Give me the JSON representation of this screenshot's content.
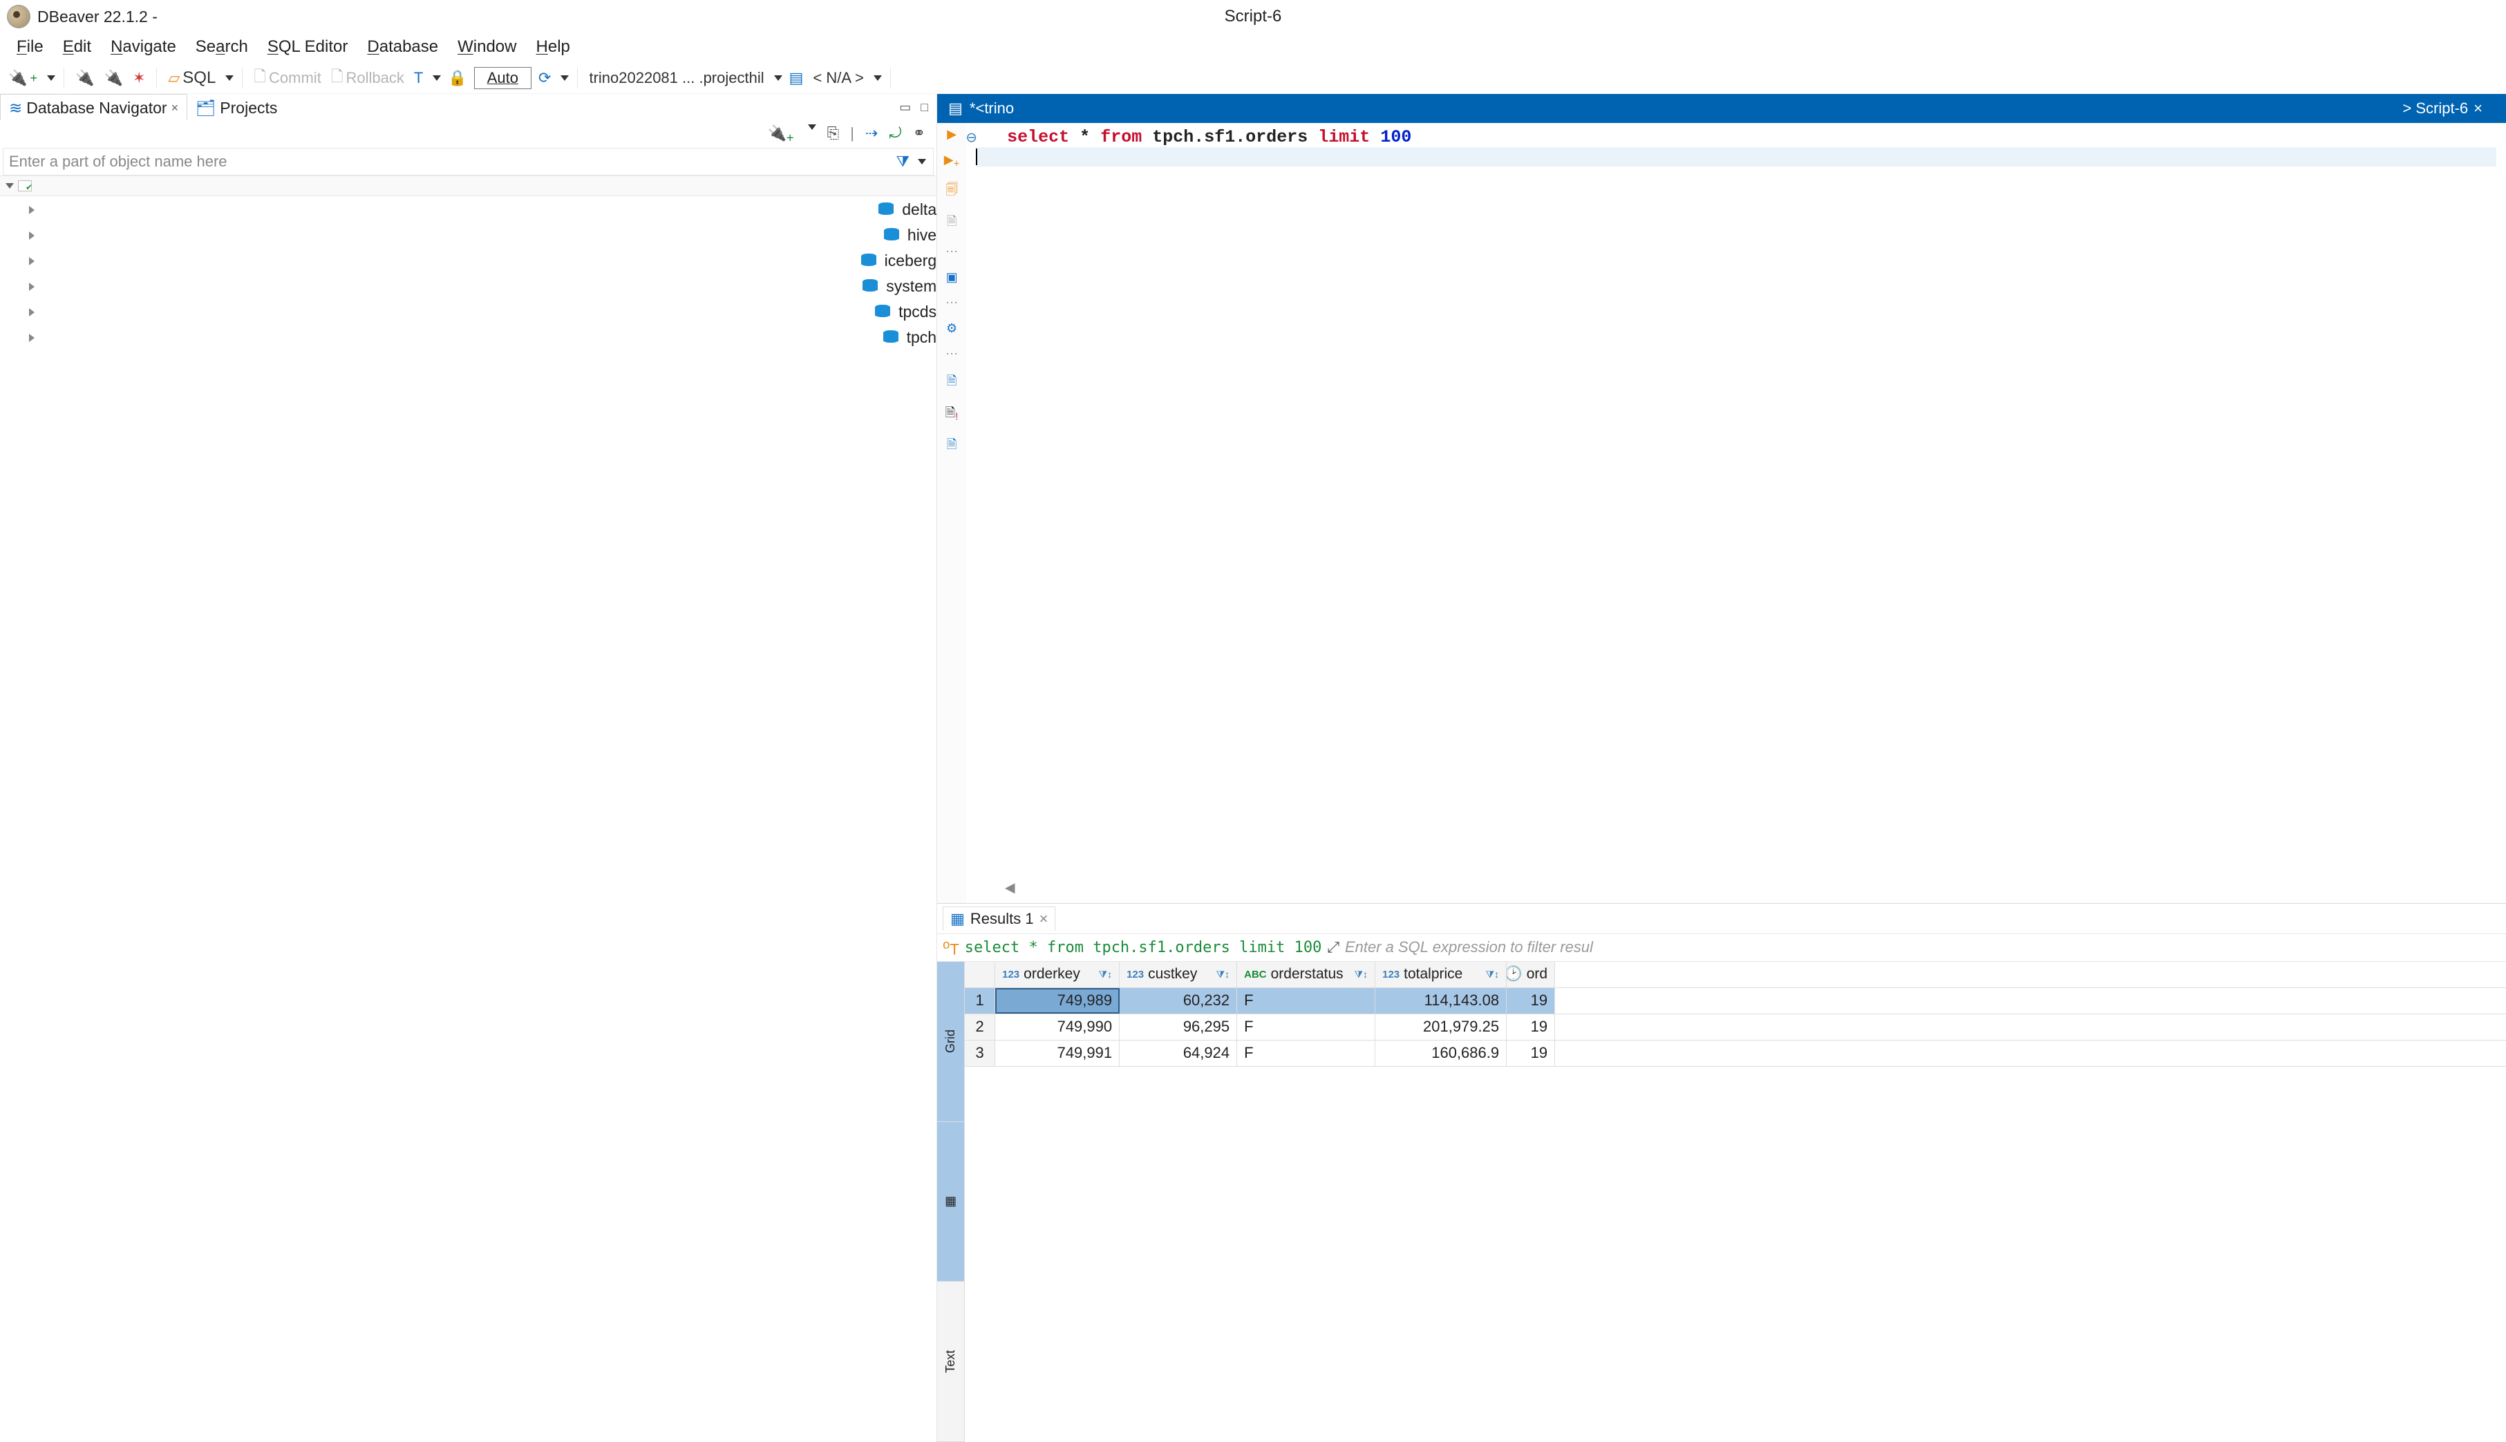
{
  "title": {
    "app": "DBeaver 22.1.2 -",
    "doc": "Script-6"
  },
  "menu": [
    "File",
    "Edit",
    "Navigate",
    "Search",
    "SQL Editor",
    "Database",
    "Window",
    "Help"
  ],
  "toolbar": {
    "sql_label": "SQL",
    "commit_label": "Commit",
    "rollback_label": "Rollback",
    "auto_label": "Auto",
    "datasource_label": "trino2022081 ... .projecthil",
    "schema_label": "< N/A >"
  },
  "nav": {
    "tabs": {
      "navigator": "Database Navigator",
      "projects": "Projects"
    },
    "filter_placeholder": "Enter a part of object name here",
    "schemas": [
      "delta",
      "hive",
      "iceberg",
      "system",
      "tpcds",
      "tpch"
    ]
  },
  "editor": {
    "tab_left": "*<trino",
    "tab_right": "> Script-6",
    "sql_tokens": {
      "select": "select",
      "star": "*",
      "from": "from",
      "table": "tpch.sf1.orders",
      "limit": "limit",
      "n": "100"
    }
  },
  "results": {
    "tab_label": "Results 1",
    "query_text": "select * from tpch.sf1.orders limit 100",
    "filter_placeholder": "Enter a SQL expression to filter resul",
    "side": {
      "grid": "Grid",
      "text": "Text"
    },
    "columns": [
      {
        "name": "orderkey",
        "type": "123"
      },
      {
        "name": "custkey",
        "type": "123"
      },
      {
        "name": "orderstatus",
        "type": "ABC"
      },
      {
        "name": "totalprice",
        "type": "123"
      },
      {
        "name": "ord",
        "type": "clock"
      }
    ],
    "rows": [
      {
        "n": "1",
        "orderkey": "749,989",
        "custkey": "60,232",
        "orderstatus": "F",
        "totalprice": "114,143.08",
        "ord": "19"
      },
      {
        "n": "2",
        "orderkey": "749,990",
        "custkey": "96,295",
        "orderstatus": "F",
        "totalprice": "201,979.25",
        "ord": "19"
      },
      {
        "n": "3",
        "orderkey": "749,991",
        "custkey": "64,924",
        "orderstatus": "F",
        "totalprice": "160,686.9",
        "ord": "19"
      }
    ]
  }
}
